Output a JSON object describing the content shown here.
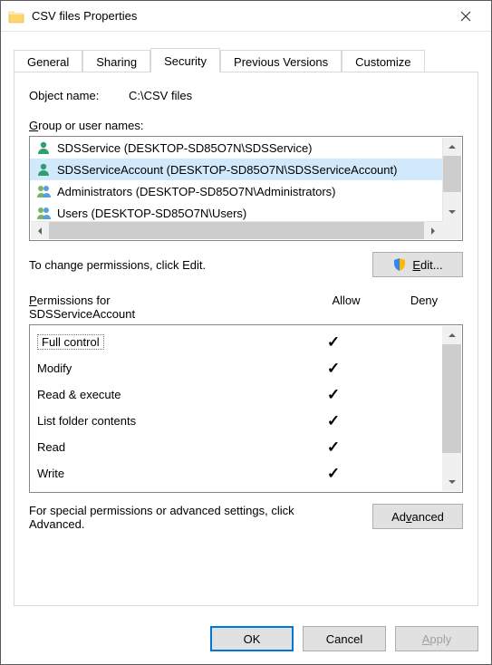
{
  "window": {
    "title": "CSV files Properties"
  },
  "tabs": [
    {
      "label": "General"
    },
    {
      "label": "Sharing"
    },
    {
      "label": "Security"
    },
    {
      "label": "Previous Versions"
    },
    {
      "label": "Customize"
    }
  ],
  "object_name_label": "Object name:",
  "object_name_value": "C:\\CSV files",
  "group_label_prefix": "G",
  "group_label_rest": "roup or user names:",
  "users": [
    {
      "label": "SDSService (DESKTOP-SD85O7N\\SDSService)",
      "type": "single",
      "selected": false
    },
    {
      "label": "SDSServiceAccount (DESKTOP-SD85O7N\\SDSServiceAccount)",
      "type": "single",
      "selected": true
    },
    {
      "label": "Administrators (DESKTOP-SD85O7N\\Administrators)",
      "type": "group",
      "selected": false
    },
    {
      "label": "Users (DESKTOP-SD85O7N\\Users)",
      "type": "group",
      "selected": false
    }
  ],
  "edit_hint": "To change permissions, click Edit.",
  "edit_button_prefix": "E",
  "edit_button_rest": "dit...",
  "perm_header_prefix": "P",
  "perm_header_rest": "ermissions for",
  "perm_header_subject": "SDSServiceAccount",
  "col_allow": "Allow",
  "col_deny": "Deny",
  "permissions": [
    {
      "name": "Full control",
      "allow": true,
      "deny": false
    },
    {
      "name": "Modify",
      "allow": true,
      "deny": false
    },
    {
      "name": "Read & execute",
      "allow": true,
      "deny": false
    },
    {
      "name": "List folder contents",
      "allow": true,
      "deny": false
    },
    {
      "name": "Read",
      "allow": true,
      "deny": false
    },
    {
      "name": "Write",
      "allow": true,
      "deny": false
    }
  ],
  "adv_text": "For special permissions or advanced settings, click Advanced.",
  "adv_button_prefix": "v",
  "adv_button_before": "Ad",
  "adv_button_after": "anced",
  "footer": {
    "ok": "OK",
    "cancel": "Cancel",
    "apply": "Apply",
    "apply_prefix": "A",
    "apply_rest": "pply"
  }
}
